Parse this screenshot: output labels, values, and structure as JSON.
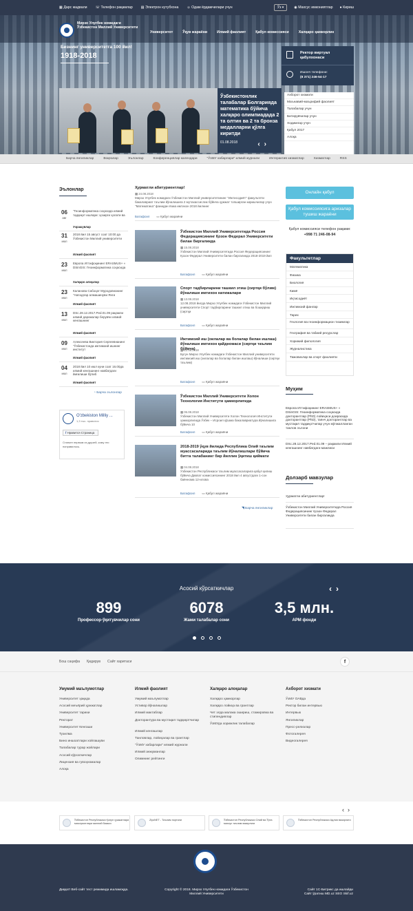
{
  "topbar": {
    "left": [
      "Дарс жадвали",
      "Телефон рақамлар",
      "Электрон кутубхона",
      "Одам ёрдамчилари учун"
    ],
    "lang": "Ўз",
    "right": [
      "Махсус имкониятлар",
      "Кириш"
    ]
  },
  "header": {
    "university_name": "Мирзо Улуғбек номидаги Ўзбекистон Миллий Университети",
    "nav": [
      "Университет",
      "Ўқув жараёни",
      "Илмий фаолият",
      "Қабул комиссияси",
      "Халқаро ҳамкорлик"
    ],
    "anniversary": "Бизнинг университетга 100 йил!",
    "years": "1918-2018"
  },
  "slider": {
    "caption": "Ўзбекистонлик талабалар Болгарияда математика бўйича халқаро олимпиадада 2 та олтин ва 2 та бронза медалларни қўлга киритди",
    "date": "01.08.2018"
  },
  "rector": {
    "title": "Ректор виртуал қабулхонаси",
    "phone_label": "Ишонч телефони:",
    "phone": "(8 371) 246-54-17"
  },
  "rector_links": [
    "Ахборот хизмати",
    "Маънавий-маърифий фаолият",
    "Талабалар учун",
    "Битирувчилар учун",
    "Ходимлар учун",
    "Қабул 2017",
    "Алоқа"
  ],
  "crumb": [
    "Барча янгиликлар",
    "Воқеалар",
    "Эълонлар",
    "Конференциялар календари",
    "\"ЎзМУ хабарлари\" илмий журнали",
    "Интерактив хизматлар",
    "Хизматлар",
    "RSS"
  ],
  "events_title": "Эълонлар",
  "events": [
    {
      "day": "06",
      "month": "авг",
      "text": "\"Геоинформатика соҳасида илмий тадқиқот ишлари: ҳозирги ҳолати ва",
      "cat": "Учрашувлар"
    },
    {
      "day": "31",
      "month": "июл",
      "text": "2018 йил 15 август соат 10:00 да Ўзбекистон Миллий университети",
      "cat": "Илмий фаолият"
    },
    {
      "day": "23",
      "month": "июл",
      "text": "Европа Иттифоқининг ERASMUS+ « DSinGIS: Геоинформатика соҳасида",
      "cat": "Халқаро алоқалар"
    },
    {
      "day": "23",
      "month": "июл",
      "text": "Каланова Сабоҳат Муродовнанинг \"Авлодлар алмашинуви Янги",
      "cat": "Илмий фаолият"
    },
    {
      "day": "13",
      "month": "июл",
      "text": "DSc.28.12.2017.Ped.01.09 рақамли илмий даражалар берувчи илмий кенгашнинг",
      "cat": "Илмий фаолият"
    },
    {
      "day": "09",
      "month": "июл",
      "text": "Алексеева Виктория Сергеевнанинг \"Ўзбекистонда ижтимоий ишнинг институт",
      "cat": "Илмий фаолият"
    },
    {
      "day": "04",
      "month": "июл",
      "text": "2018 йил 10 июл куни соат 16.00да илмий кенгашнинг навбатдаги йиғилиши бўлиб",
      "cat": "Илмий фаолият"
    }
  ],
  "events_all": "Барча эълонлар",
  "facebook": {
    "name": "O'zbekiston Milliy ...",
    "sub": "1,3 тыс. нравится",
    "like": "Нравится Страница",
    "msg": "Станьте первым из друзей, кому это понравилось."
  },
  "news": [
    {
      "title": "Ҳурматли абитуриентлар!",
      "date": "24.08.2018",
      "excerpt": "Мирзо Улуғбек номидаги Ўзбекистон Миллий университетининг \"Ижтисодиёт\" факультети бакалавриат таълим йўналишига 2 мутахассислик бўйича ҳужжат топширган киришчилар учун \"Математика\" фанидан ёзма имтихон 2018 йилнинг",
      "more": "Батафсил",
      "cat": "Қабул жараёни"
    },
    {
      "title": "Ўзбекистон Миллий Университетида Россия Федерациясининг Қозон Федерал Университети билан биргаликда",
      "date": "15.08.2018",
      "excerpt": "Ўзбекистон Миллий Университетида Россия Федерациясининг Қозон Федерал Университети билан биргаликда 2018-2019 йил",
      "more": "Батафсил",
      "cat": "Қабул жараёни"
    },
    {
      "title": "Спорт тадбирларини ташкил этиш (сиртқи бўлим) йўналиши имтихон натижалари",
      "date": "13.08.2018",
      "excerpt": "12.08.2018 йилда Мирзо Улуғбек номидаги Ўзбекистон Миллий университети Спорт тадбирларини ташкил этиш ва бошқариш (сиртқи",
      "more": "Батафсил",
      "cat": "Қабул жараёни"
    },
    {
      "title": "Ижтимоий иш (оилалар ва болалар билан ишлаш) йўналиши имтихон қайдномаси (сиртқи таълим бўйича)",
      "date": "12.08.2018",
      "excerpt": "Бугун Мирзо Улуғбек номидаги Ўзбекистон Миллий университети ижтимоий иш (оилалар ва болалар билан ишлаш) йўналиши (сиртқи таълим)",
      "more": "Батафсил",
      "cat": "Қабул жараёни"
    },
    {
      "title": "Ўзбекистон Миллий Университети Холон Технология Институти ҳамкорлигида",
      "date": "06.08.2018",
      "excerpt": "Ўзбекистон Миллий Университети Холон Технология Институти ҳамкорлигида Ўзбек – Исроил қўшма бакалавриатура йўналишига бўйича 10",
      "more": "Батафсил",
      "cat": "Қабул жараёни"
    },
    {
      "title": "2018-2019 ўқув йилида Республика Олий таълим муассасаларида таълим йўналишлари бўйича битта талабанинг бир йиллик ўқитиш қиймати",
      "date": "04.08.2018",
      "excerpt": "Ўзбекистон Республикаси таълим муассасаларига қабул қилиш бўйича Давлат комиссиясининг 2018 йил 4 августдаги 1-сон баённома 12-илова",
      "more": "Батафсил",
      "cat": "Қабул жараёни"
    }
  ],
  "news_all": "Барча янгиликлар",
  "right": {
    "online": "Онлайн қабул",
    "admissions_btn": "Қабул комиссиясига аризалар тушиш жараёни",
    "admissions_label": "Қабул комиссияси телефон рақами:",
    "admissions_phone": "+998 71 246-08-94",
    "faculties_title": "Факультетлар",
    "faculties": [
      "Математика",
      "Физика",
      "Биология",
      "Кимё",
      "Иқтисодиёт",
      "Ижтимоий фанлар",
      "Тарих",
      "Геология ва геоинформацион тизимлар",
      "География ва табиий ресурслар",
      "Хорижий филология",
      "Журналистика",
      "Тажовизлар ва спорт фаолияти"
    ],
    "important_title": "Муҳим",
    "important": [
      "Европа Иттифоқининг ERASMUS+ « DSinGIS: Геоинформатика соҳасида докторантлар (PhD) лойиҳаси доирасида докторантлар (PhD), таянч докторантлар ва мустақил тадқиқотчилар учун мўлжалланган танлов эълони",
      "DSc.28.12.2017.Ped.01.09 – рақамли Илмий кенгашнинг навбатдаги мажлиси"
    ],
    "topical_title": "Долзарб мавзулар",
    "topical": [
      "Ҳурматли абитуриентлар!",
      "Ўзбекистон Миллий Университетида Россия Федерациясининг Қозон Федерал Университети билан биргаликда"
    ]
  },
  "stats": {
    "title": "Асосий кўрсаткичлар",
    "items": [
      {
        "value": "899",
        "label": "Профессор-ўқитувчилар сони"
      },
      {
        "value": "6078",
        "label": "Жами талабалар сони"
      },
      {
        "value": "3,5 млн.",
        "label": "АРМ фонди"
      }
    ]
  },
  "footer_bar": [
    "Бош саҳифа",
    "Қидирув",
    "Сайт харитаси"
  ],
  "footer_cols": [
    {
      "title": "Умумий маълумотлар",
      "items": [
        "Университет ҳақида",
        "Асосий меъёрий ҳужжатлар",
        "Университет тарихи",
        "Ректорат",
        "Университет Кенгаши",
        "Тузилма",
        "Бино иншоатлари хойлашуви",
        "Талабалар турар жойлари",
        "Асосий кўрсаткичлар",
        "Лицензия ва гувоҳномалар",
        "Алоқа"
      ]
    },
    {
      "title": "Илмий фаолият",
      "items": [
        "Умумий маълумотлар",
        "Устивор йўналишлар",
        "Илмий мактаблар",
        "Докторантура ва мустақил тадқиқотчилар",
        "Илмий кенгашлар",
        "Танловлар, лойиҳалар ва грантлар",
        "\"ЎзМУ хабарлари\" илмий журнали",
        "Илмий анжуманлар",
        "Олимнинг рейтинги"
      ]
    },
    {
      "title": "Халқаро алоқалар",
      "items": [
        "Халқаро ҳамкорлар",
        "Халқаро лойиҳа ва грантлар",
        "Чет элда малака ошириш, стажировка ва стипендиялар",
        "ЎзМУда хорижлик талабалар"
      ]
    },
    {
      "title": "Ахборот хизмати",
      "items": [
        "ЎзМУ ОАВда",
        "Ректор билан интервью",
        "Интервью",
        "Янгиликлар",
        "Пресс-релизлар",
        "Фотогалерея",
        "Видеогалерея"
      ]
    }
  ],
  "partners": [
    "Ўзбекистон Республикаси Қонун ҳужжатлари маълумотлари миллий базаси",
    "ZiyoNET - Таълим портали",
    "Ўзбекистон Республикаси Олий ва Ўрта махсус таълим вазирлиги",
    "Ўзбекистон Республикаси Адлия вазирлиги"
  ],
  "footer": {
    "left": "Диққат! Веб-сайт тест режимида ишламоқда.",
    "copy": "Copyright © 2018. Мирзо Улуғбек номидаги Ўзбекистон Миллий Университети",
    "right1": "Сайт 1С-Битрикс да ишлайди",
    "right2": "Сайт ўратиш MD.uz SEO Skif.uz"
  }
}
